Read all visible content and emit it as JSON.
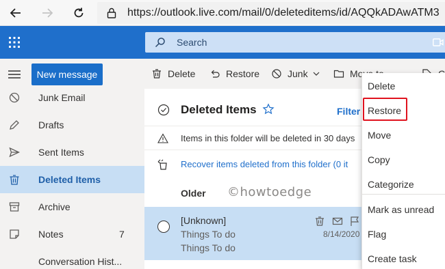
{
  "browser": {
    "url": "https://outlook.live.com/mail/0/deleteditems/id/AQQkADAwATM3"
  },
  "header": {
    "search_placeholder": "Search"
  },
  "left_nav": {
    "new_message": "New message",
    "folders": [
      {
        "label": "Junk Email",
        "icon": "blocked-icon"
      },
      {
        "label": "Drafts",
        "icon": "pencil-icon"
      },
      {
        "label": "Sent Items",
        "icon": "send-icon"
      },
      {
        "label": "Deleted Items",
        "icon": "trash-icon",
        "selected": true
      },
      {
        "label": "Archive",
        "icon": "archive-icon"
      },
      {
        "label": "Notes",
        "icon": "note-icon",
        "count": "7"
      },
      {
        "label": "Conversation Hist...",
        "icon": "folder-icon"
      }
    ]
  },
  "command_bar": {
    "delete": "Delete",
    "restore": "Restore",
    "junk": "Junk",
    "move_to": "Move to",
    "categorize": "Cat"
  },
  "message_list": {
    "title": "Deleted Items",
    "filter": "Filter",
    "info_text": "Items in this folder will be deleted in 30 days",
    "recover_text": "Recover items deleted from this folder (0 it",
    "group_header": "Older",
    "watermark": "©howtoedge",
    "messages": [
      {
        "sender": "[Unknown]",
        "subject": "Things To do",
        "preview": "Things To do",
        "date": "8/14/2020"
      }
    ]
  },
  "context_menu": {
    "items": [
      "Delete",
      "Restore",
      "Move",
      "Copy",
      "Categorize",
      "Mark as unread",
      "Flag",
      "Create task"
    ],
    "highlighted": "Restore",
    "highlight_color": "#e0121e"
  },
  "colors": {
    "brand": "#1f6fcb",
    "selected_bg": "#c7def4",
    "nav_bg": "#f3f2f1"
  }
}
